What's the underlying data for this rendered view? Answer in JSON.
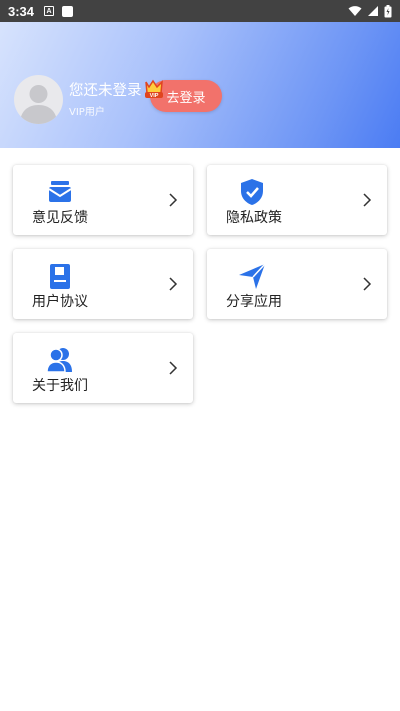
{
  "status_bar": {
    "time": "3:34",
    "icons": [
      "a-notification-icon",
      "square-notification-icon",
      "wifi-icon",
      "signal-icon",
      "battery-icon"
    ]
  },
  "profile": {
    "name": "您还未登录",
    "subtitle": "VIP用户",
    "vip_badge": "VIP",
    "login_button": "去登录"
  },
  "menu": [
    {
      "label": "意见反馈",
      "icon": "mail-icon"
    },
    {
      "label": "隐私政策",
      "icon": "shield-check-icon"
    },
    {
      "label": "用户协议",
      "icon": "document-icon"
    },
    {
      "label": "分享应用",
      "icon": "send-icon"
    },
    {
      "label": "关于我们",
      "icon": "users-icon"
    }
  ],
  "colors": {
    "accent": "#2b72e8",
    "login_button": "#f2726b",
    "header_gradient_start": "#d7e3fd",
    "header_gradient_end": "#4b7cf3"
  }
}
